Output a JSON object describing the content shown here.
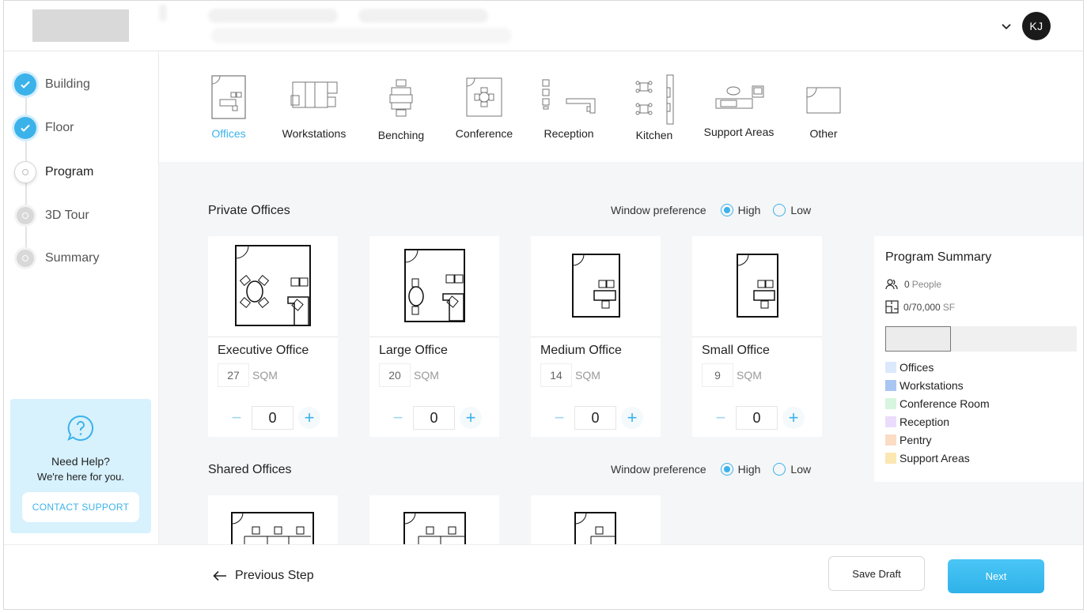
{
  "header": {
    "avatar_initials": "KJ"
  },
  "steps": [
    {
      "label": "Building",
      "state": "done"
    },
    {
      "label": "Floor",
      "state": "done"
    },
    {
      "label": "Program",
      "state": "current"
    },
    {
      "label": "3D Tour",
      "state": "todo"
    },
    {
      "label": "Summary",
      "state": "todo"
    }
  ],
  "help": {
    "title": "Need Help?",
    "subtitle": "We're here for you.",
    "button": "CONTACT SUPPORT"
  },
  "categories": [
    {
      "label": "Offices",
      "selected": true
    },
    {
      "label": "Workstations"
    },
    {
      "label": "Benching"
    },
    {
      "label": "Conference"
    },
    {
      "label": "Reception"
    },
    {
      "label": "Kitchen"
    },
    {
      "label": "Support Areas"
    },
    {
      "label": "Other"
    }
  ],
  "private": {
    "title": "Private Offices",
    "window_pref_label": "Window preference",
    "high": "High",
    "low": "Low",
    "cards": [
      {
        "name": "Executive Office",
        "area": "27",
        "unit": "SQM",
        "qty": "0"
      },
      {
        "name": "Large Office",
        "area": "20",
        "unit": "SQM",
        "qty": "0"
      },
      {
        "name": "Medium Office",
        "area": "14",
        "unit": "SQM",
        "qty": "0"
      },
      {
        "name": "Small Office",
        "area": "9",
        "unit": "SQM",
        "qty": "0"
      }
    ]
  },
  "shared": {
    "title": "Shared Offices",
    "window_pref_label": "Window preference",
    "high": "High",
    "low": "Low"
  },
  "summary": {
    "title": "Program Summary",
    "people_count": "0",
    "people_label": "People",
    "area_value": "0/70,000",
    "area_unit": "SF",
    "legend": [
      {
        "label": "Offices",
        "color": "#dbe9fb"
      },
      {
        "label": "Workstations",
        "color": "#a9c6f3"
      },
      {
        "label": "Conference Room",
        "color": "#d7f5df"
      },
      {
        "label": "Reception",
        "color": "#ecdcfb"
      },
      {
        "label": "Pentry",
        "color": "#fbdcc4"
      },
      {
        "label": "Support Areas",
        "color": "#fbe7b2"
      }
    ]
  },
  "footer": {
    "previous": "Previous Step",
    "save_draft": "Save Draft",
    "next": "Next"
  }
}
